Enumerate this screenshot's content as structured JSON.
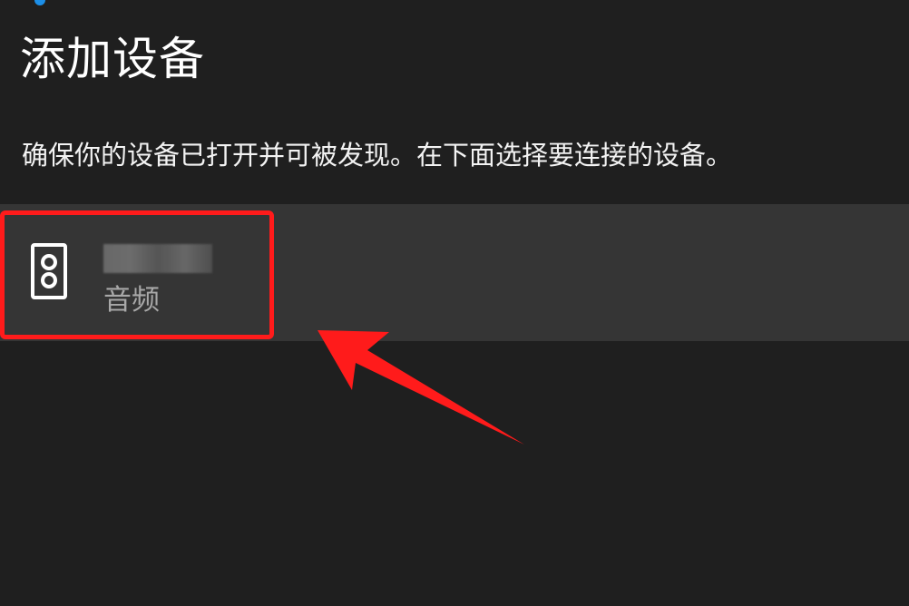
{
  "window": {
    "title": "添加设备"
  },
  "instructions": {
    "text": "确保你的设备已打开并可被发现。在下面选择要连接的设备。"
  },
  "devices": [
    {
      "name": "",
      "category": "音频",
      "icon": "speaker-icon"
    }
  ],
  "annotations": {
    "highlight_color": "#ff1b1b",
    "arrow_color": "#ff1b1b"
  },
  "colors": {
    "background": "#1f1f1f",
    "device_row": "#353535",
    "accent": "#1c8fe8",
    "title_text": "#ffffff",
    "secondary_text": "#a8a8a8"
  }
}
